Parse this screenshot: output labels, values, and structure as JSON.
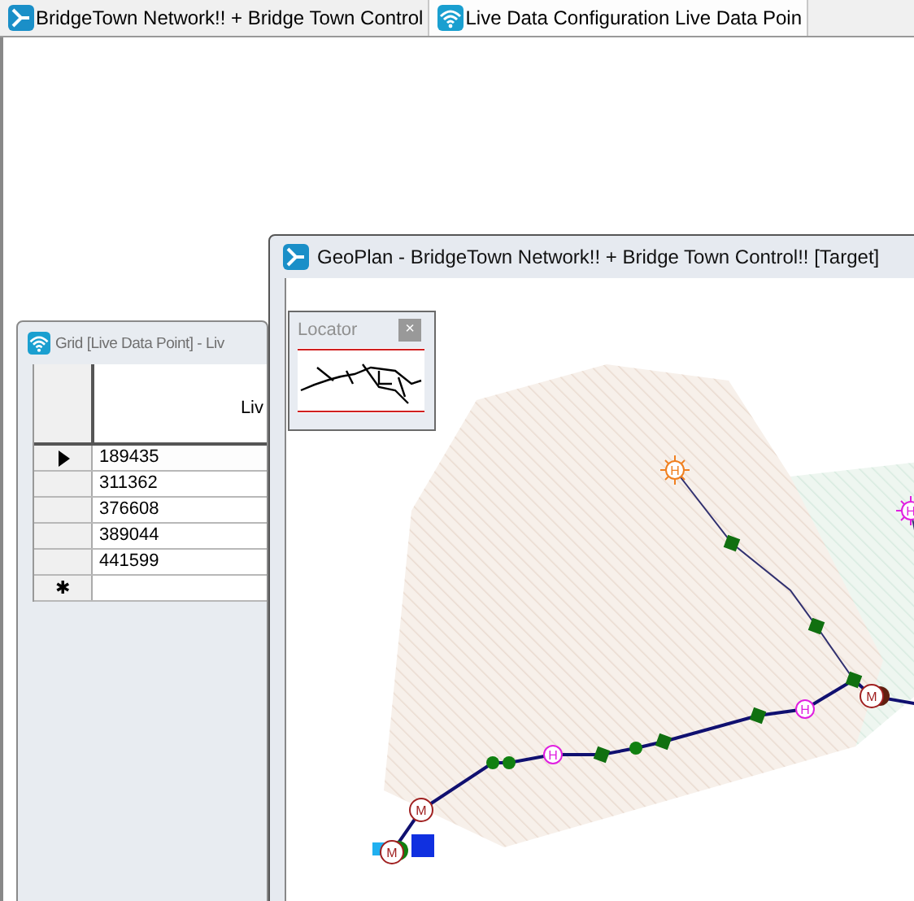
{
  "tabs": [
    {
      "label": "BridgeTown Network!! + Bridge Town Control",
      "selected": false
    },
    {
      "label": "Live Data Configuration Live Data Poin",
      "selected": true
    }
  ],
  "grid_window": {
    "title": "Grid [Live Data Point] - Liv",
    "column_1": "Liv",
    "rows": [
      {
        "value": "189435",
        "selected": true
      },
      {
        "value": "311362",
        "selected": false
      },
      {
        "value": "376608",
        "selected": false
      },
      {
        "value": "389044",
        "selected": false
      },
      {
        "value": "441599",
        "selected": false
      }
    ],
    "new_row_marker": "✱"
  },
  "geoplan_window": {
    "title": "GeoPlan - BridgeTown Network!! + Bridge Town Control!! [Target]",
    "locator": {
      "title": "Locator",
      "close": "×"
    },
    "map_nodes": [
      {
        "kind": "meter",
        "symbol": "M",
        "color": "#a02020"
      },
      {
        "kind": "meter",
        "symbol": "M",
        "color": "#a02020"
      },
      {
        "kind": "meter",
        "symbol": "M",
        "color": "#a02020"
      },
      {
        "kind": "hydrant",
        "symbol": "H",
        "color": "#e020e0"
      },
      {
        "kind": "hydrant",
        "symbol": "H",
        "color": "#e020e0"
      },
      {
        "kind": "hydrant",
        "symbol": "H",
        "color": "#e020e0"
      },
      {
        "kind": "hydrant",
        "symbol": "H",
        "color": "#f08020"
      }
    ]
  }
}
